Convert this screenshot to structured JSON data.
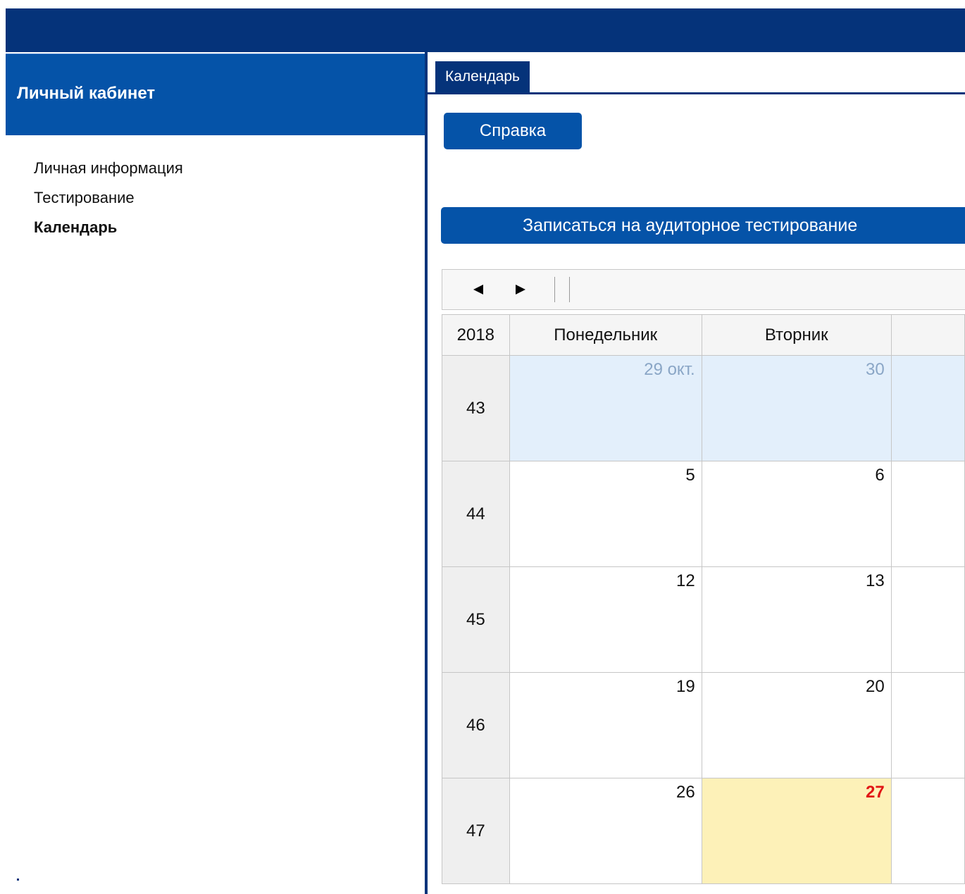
{
  "sidebar": {
    "title": "Личный кабинет",
    "items": [
      {
        "label": "Личная информация",
        "active": false
      },
      {
        "label": "Тестирование",
        "active": false
      },
      {
        "label": "Календарь",
        "active": true
      }
    ]
  },
  "tab": {
    "label": "Календарь"
  },
  "buttons": {
    "help": "Справка",
    "register": "Записаться на аудиторное тестирование"
  },
  "toolbar": {
    "prev_icon": "left-arrow-icon",
    "next_icon": "right-arrow-icon"
  },
  "calendar": {
    "year": "2018",
    "days": [
      "Понедельник",
      "Вторник"
    ],
    "weeks": [
      {
        "number": "43",
        "cells": [
          {
            "label": "29 окт.",
            "state": "other"
          },
          {
            "label": "30",
            "state": "other"
          }
        ]
      },
      {
        "number": "44",
        "cells": [
          {
            "label": "5",
            "state": "normal"
          },
          {
            "label": "6",
            "state": "normal"
          }
        ]
      },
      {
        "number": "45",
        "cells": [
          {
            "label": "12",
            "state": "normal"
          },
          {
            "label": "13",
            "state": "normal"
          }
        ]
      },
      {
        "number": "46",
        "cells": [
          {
            "label": "19",
            "state": "normal"
          },
          {
            "label": "20",
            "state": "normal"
          }
        ]
      },
      {
        "number": "47",
        "cells": [
          {
            "label": "26",
            "state": "normal"
          },
          {
            "label": "27",
            "state": "today"
          }
        ]
      }
    ]
  },
  "colors": {
    "header_dark": "#05337a",
    "primary_blue": "#0553a8",
    "other_month_bg": "#e3effb",
    "today_bg": "#fdf1b8",
    "today_text": "#e11515"
  }
}
